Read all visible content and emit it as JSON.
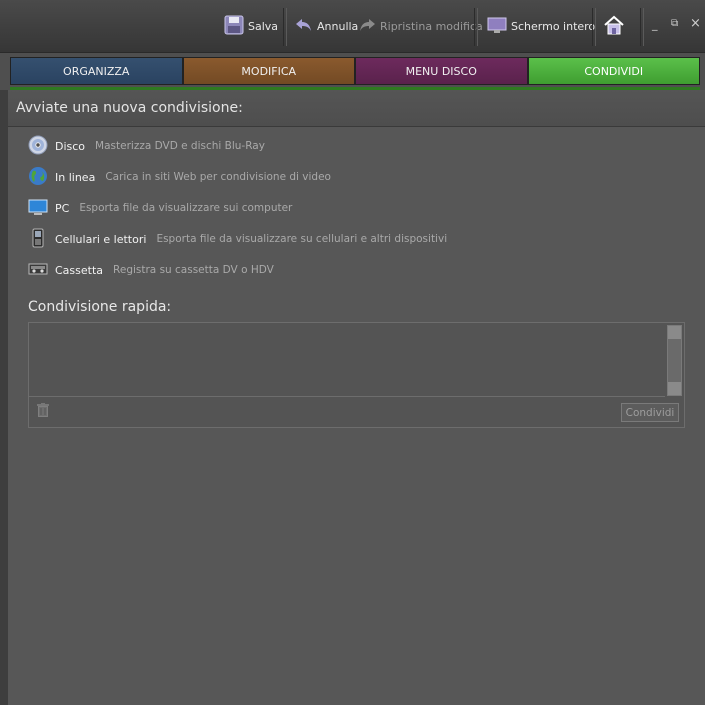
{
  "toolbar": {
    "save_label": "Salva",
    "undo_label": "Annulla",
    "redo_label": "Ripristina modifica",
    "fullscreen_label": "Schermo intero",
    "home_icon": "home-icon",
    "minimize": "_",
    "restore": "⧉",
    "close": "×"
  },
  "tabs": [
    {
      "label": "ORGANIZZA",
      "color": "#35506f"
    },
    {
      "label": "MODIFICA",
      "color": "#8a5a2e"
    },
    {
      "label": "MENU DISCO",
      "color": "#6d2a5d"
    },
    {
      "label": "CONDIVIDI",
      "color": "#4fb33f",
      "active": true
    }
  ],
  "panel": {
    "title": "Avviate una nuova condivisione:",
    "options": [
      {
        "name": "Disco",
        "desc": "Masterizza DVD e dischi Blu-Ray",
        "icon": "disc-icon"
      },
      {
        "name": "In linea",
        "desc": "Carica in siti Web per condivisione di video",
        "icon": "globe-icon"
      },
      {
        "name": "PC",
        "desc": "Esporta file da visualizzare sui computer",
        "icon": "monitor-icon"
      },
      {
        "name": "Cellulari e lettori",
        "desc": "Esporta file da visualizzare su cellulari e altri dispositivi",
        "icon": "phone-icon"
      },
      {
        "name": "Cassetta",
        "desc": "Registra su cassetta DV o HDV",
        "icon": "tape-icon"
      }
    ],
    "quick_share": {
      "title": "Condivisione rapida:",
      "share_button": "Condividi"
    }
  }
}
